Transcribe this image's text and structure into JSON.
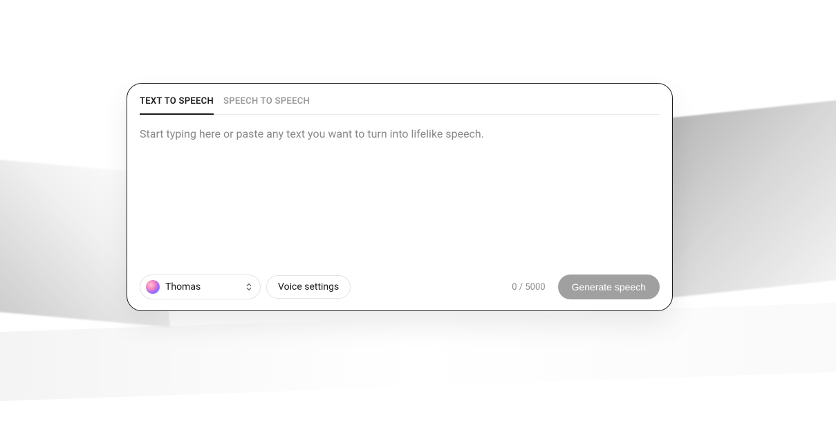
{
  "tabs": {
    "text_to_speech": "TEXT TO SPEECH",
    "speech_to_speech": "SPEECH TO SPEECH"
  },
  "editor": {
    "placeholder": "Start typing here or paste any text you want to turn into lifelike speech.",
    "value": ""
  },
  "voice": {
    "selected_name": "Thomas"
  },
  "controls": {
    "voice_settings_label": "Voice settings",
    "generate_label": "Generate speech"
  },
  "char_counter": {
    "display": "0 / 5000",
    "current": 0,
    "max": 5000
  }
}
